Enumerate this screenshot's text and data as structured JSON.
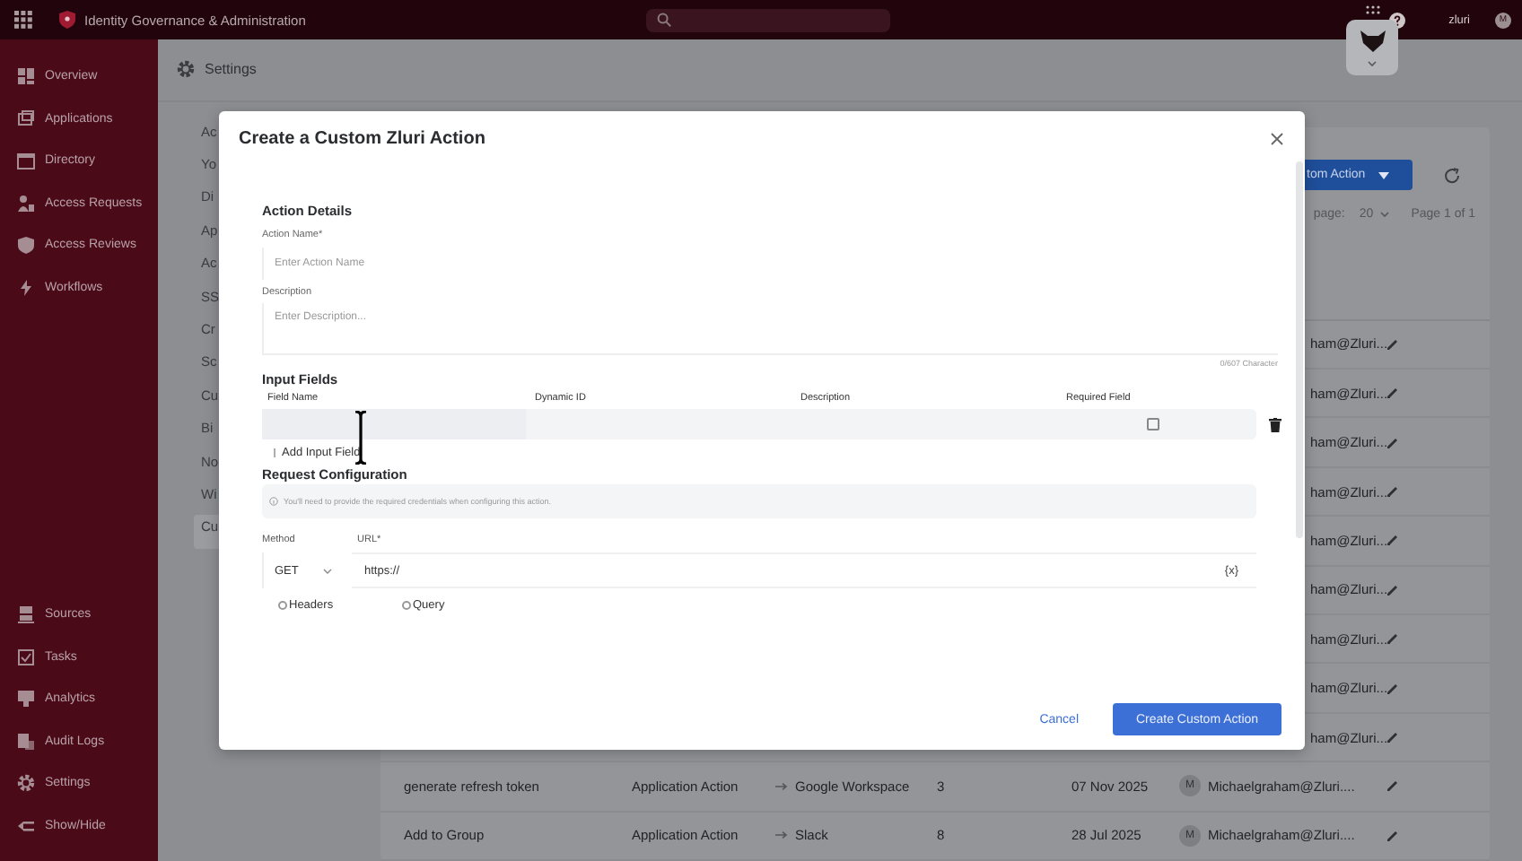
{
  "topbar": {
    "title": "Identity Governance & Administration",
    "org": "zluri",
    "avatar": "M"
  },
  "sidebar": {
    "items": [
      {
        "label": "Overview"
      },
      {
        "label": "Applications"
      },
      {
        "label": "Directory"
      },
      {
        "label": "Access Requests"
      },
      {
        "label": "Access Reviews"
      },
      {
        "label": "Workflows"
      }
    ],
    "bottom_items": [
      {
        "label": "Sources"
      },
      {
        "label": "Tasks"
      },
      {
        "label": "Analytics"
      },
      {
        "label": "Audit Logs"
      },
      {
        "label": "Settings"
      },
      {
        "label": "Show/Hide"
      }
    ]
  },
  "page": {
    "title": "Settings",
    "settings_menu": [
      {
        "label": "Ac",
        "selected": false
      },
      {
        "label": "Yo",
        "selected": false
      },
      {
        "label": "Di",
        "selected": false
      },
      {
        "label": "Ap",
        "selected": false
      },
      {
        "label": "Ac",
        "selected": false
      },
      {
        "label": "SS",
        "selected": false
      },
      {
        "label": "Cr",
        "selected": false
      },
      {
        "label": "Sc",
        "selected": false
      },
      {
        "label": "Cu",
        "selected": false
      },
      {
        "label": "Bi",
        "selected": false
      },
      {
        "label": "No",
        "selected": false
      },
      {
        "label": "Wi",
        "selected": false
      },
      {
        "label": "Cu",
        "selected": true
      }
    ],
    "add_button": "tom Action",
    "per_page_label": "page:",
    "per_page": "20",
    "page_info": "Page 1 of 1",
    "rows": [
      {
        "kind": "partial",
        "user": "ham@Zluri...."
      },
      {
        "kind": "partial",
        "user": "ham@Zluri...."
      },
      {
        "kind": "partial",
        "user": "ham@Zluri...."
      },
      {
        "kind": "partial",
        "user": "ham@Zluri...."
      },
      {
        "kind": "partial",
        "user": "ham@Zluri...."
      },
      {
        "kind": "partial",
        "user": "ham@Zluri...."
      },
      {
        "kind": "partial",
        "user": "ham@Zluri...."
      },
      {
        "kind": "partial",
        "user": "ham@Zluri...."
      },
      {
        "kind": "partial",
        "user": "ham@Zluri...."
      },
      {
        "kind": "full",
        "name": "generate refresh token",
        "type": "Application Action",
        "app": "Google Workspace",
        "count": "3",
        "date": "07 Nov 2025",
        "avatar": "M",
        "user": "Michaelgraham@Zluri...."
      },
      {
        "kind": "full",
        "name": "Add to Group",
        "type": "Application Action",
        "app": "Slack",
        "count": "8",
        "date": "28 Jul 2025",
        "avatar": "M",
        "user": "Michaelgraham@Zluri...."
      }
    ]
  },
  "modal": {
    "title": "Create a Custom Zluri Action",
    "details": {
      "heading": "Action Details",
      "name_label": "Action Name*",
      "name_placeholder": "Enter Action Name",
      "description_label": "Description",
      "description_placeholder": "Enter Description...",
      "counter": "0/607 Character"
    },
    "input_fields": {
      "heading": "Input Fields",
      "columns": [
        "Field Name",
        "Dynamic ID",
        "Description",
        "Required Field"
      ],
      "rows": [
        {
          "required": false
        }
      ],
      "add_link": "Add Input Field"
    },
    "request": {
      "heading": "Request Configuration",
      "info": "You'll need to provide the required credentials when configuring this action.",
      "method_label": "Method",
      "url_label": "URL*",
      "method": "GET",
      "url": "https://",
      "variable": "{x}",
      "options": [
        {
          "label": "Headers",
          "selected": false
        },
        {
          "label": "Query",
          "selected": false
        }
      ]
    },
    "cancel": "Cancel",
    "submit": "Create Custom Action"
  }
}
